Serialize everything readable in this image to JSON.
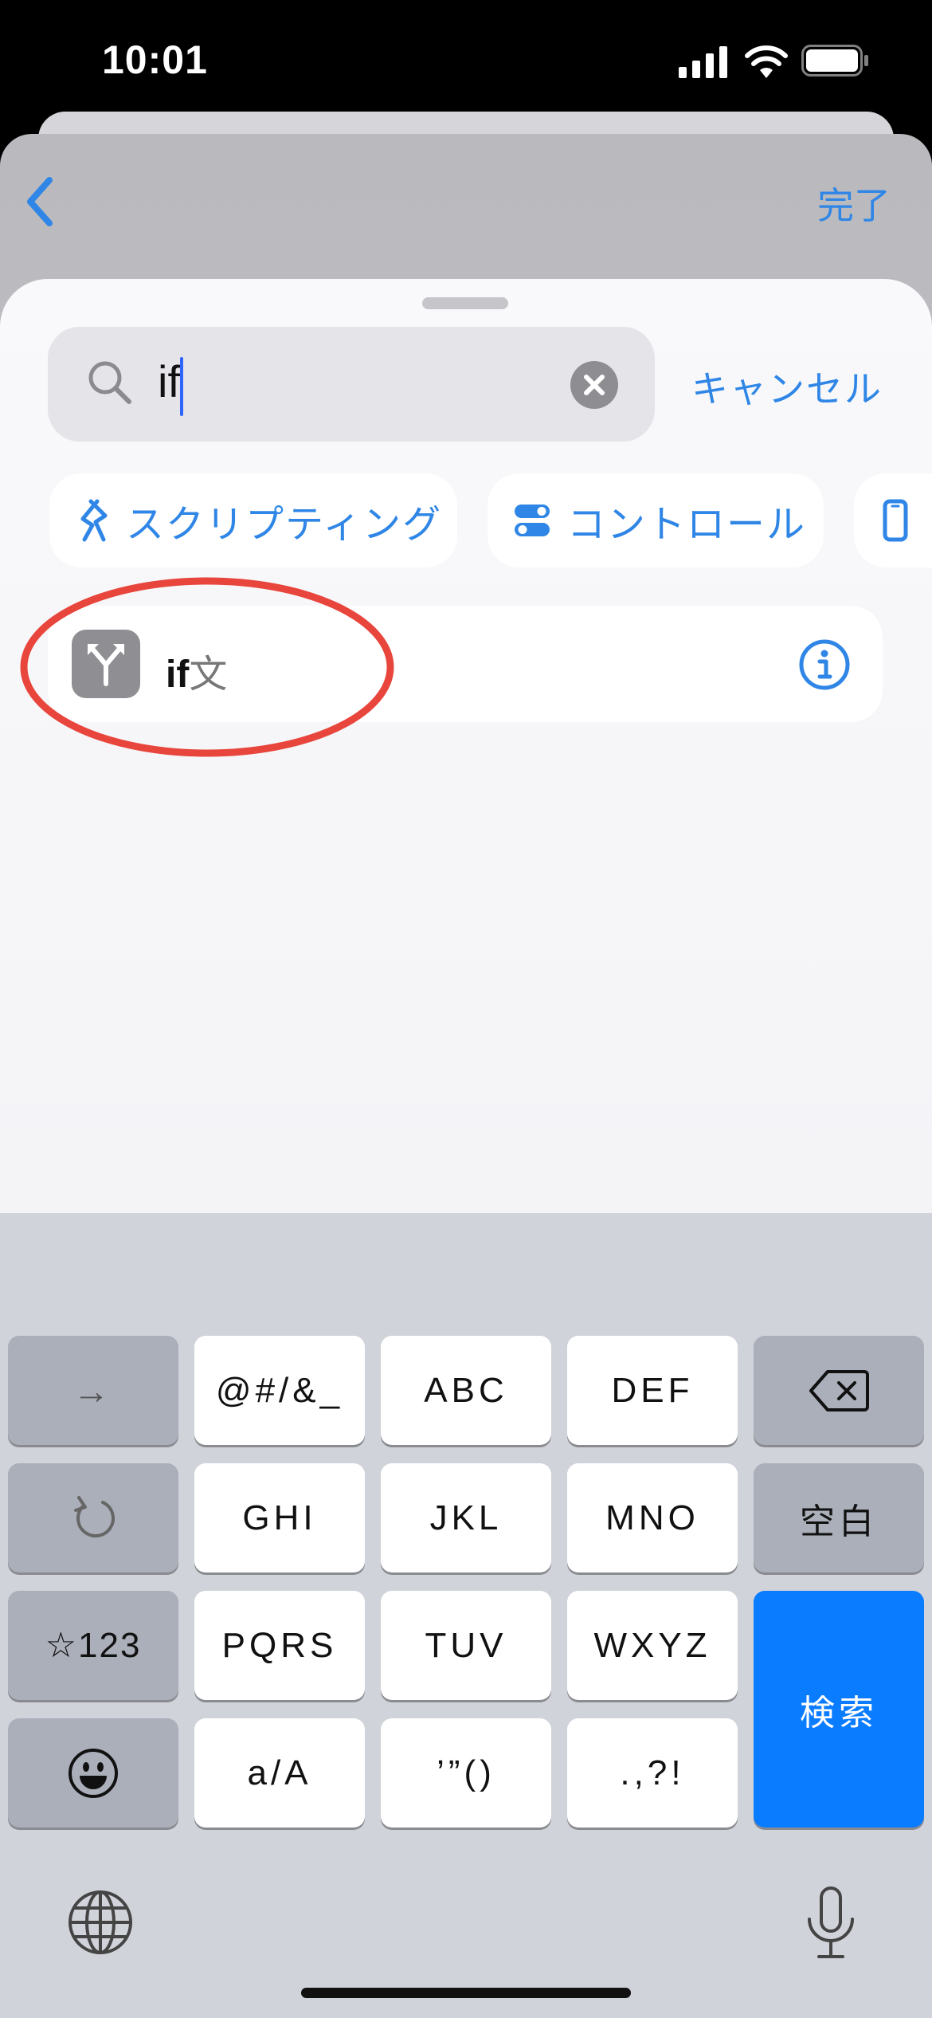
{
  "status": {
    "time": "10:01"
  },
  "nav": {
    "done_label": "完了"
  },
  "search": {
    "query": "if",
    "cancel_label": "キャンセル"
  },
  "categories": [
    {
      "label": "スクリプティング",
      "icon": "scripting-icon"
    },
    {
      "label": "コントロール",
      "icon": "toggle-icon"
    },
    {
      "label": "",
      "icon": "phone-icon"
    }
  ],
  "result": {
    "match": "if",
    "rest": "文",
    "icon": "branch-icon"
  },
  "keyboard": {
    "row1": [
      "→",
      "@#/&_",
      "ABC",
      "DEF",
      "⌫"
    ],
    "row2": [
      "↺",
      "GHI",
      "JKL",
      "MNO",
      "空白"
    ],
    "row3": [
      "☆123",
      "PQRS",
      "TUV",
      "WXYZ"
    ],
    "row4": [
      "☺",
      "a/A",
      "’”()",
      ".,?!"
    ],
    "search_key": "検索"
  },
  "colors": {
    "accent": "#2f86e6",
    "annotation": "#e8453c",
    "search_key": "#0a7cff"
  }
}
